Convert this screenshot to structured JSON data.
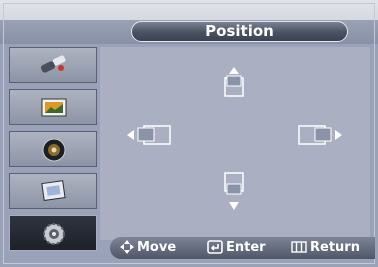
{
  "header": {
    "title": "Position"
  },
  "sidebar": {
    "items": [
      {
        "name": "input-icon",
        "active": false
      },
      {
        "name": "picture-icon",
        "active": false
      },
      {
        "name": "sound-icon",
        "active": false
      },
      {
        "name": "channel-icon",
        "active": false
      },
      {
        "name": "setup-icon",
        "active": true
      }
    ]
  },
  "main": {
    "arrows": [
      "up-arrow-icon",
      "left-arrow-icon",
      "right-arrow-icon",
      "down-arrow-icon"
    ]
  },
  "footer": {
    "move_label": "Move",
    "enter_label": "Enter",
    "return_label": "Return"
  },
  "colors": {
    "background": "#99a2b8",
    "title_pill": "#4a5163",
    "active_item": "#1d2028",
    "panel": "#aab0c2"
  }
}
